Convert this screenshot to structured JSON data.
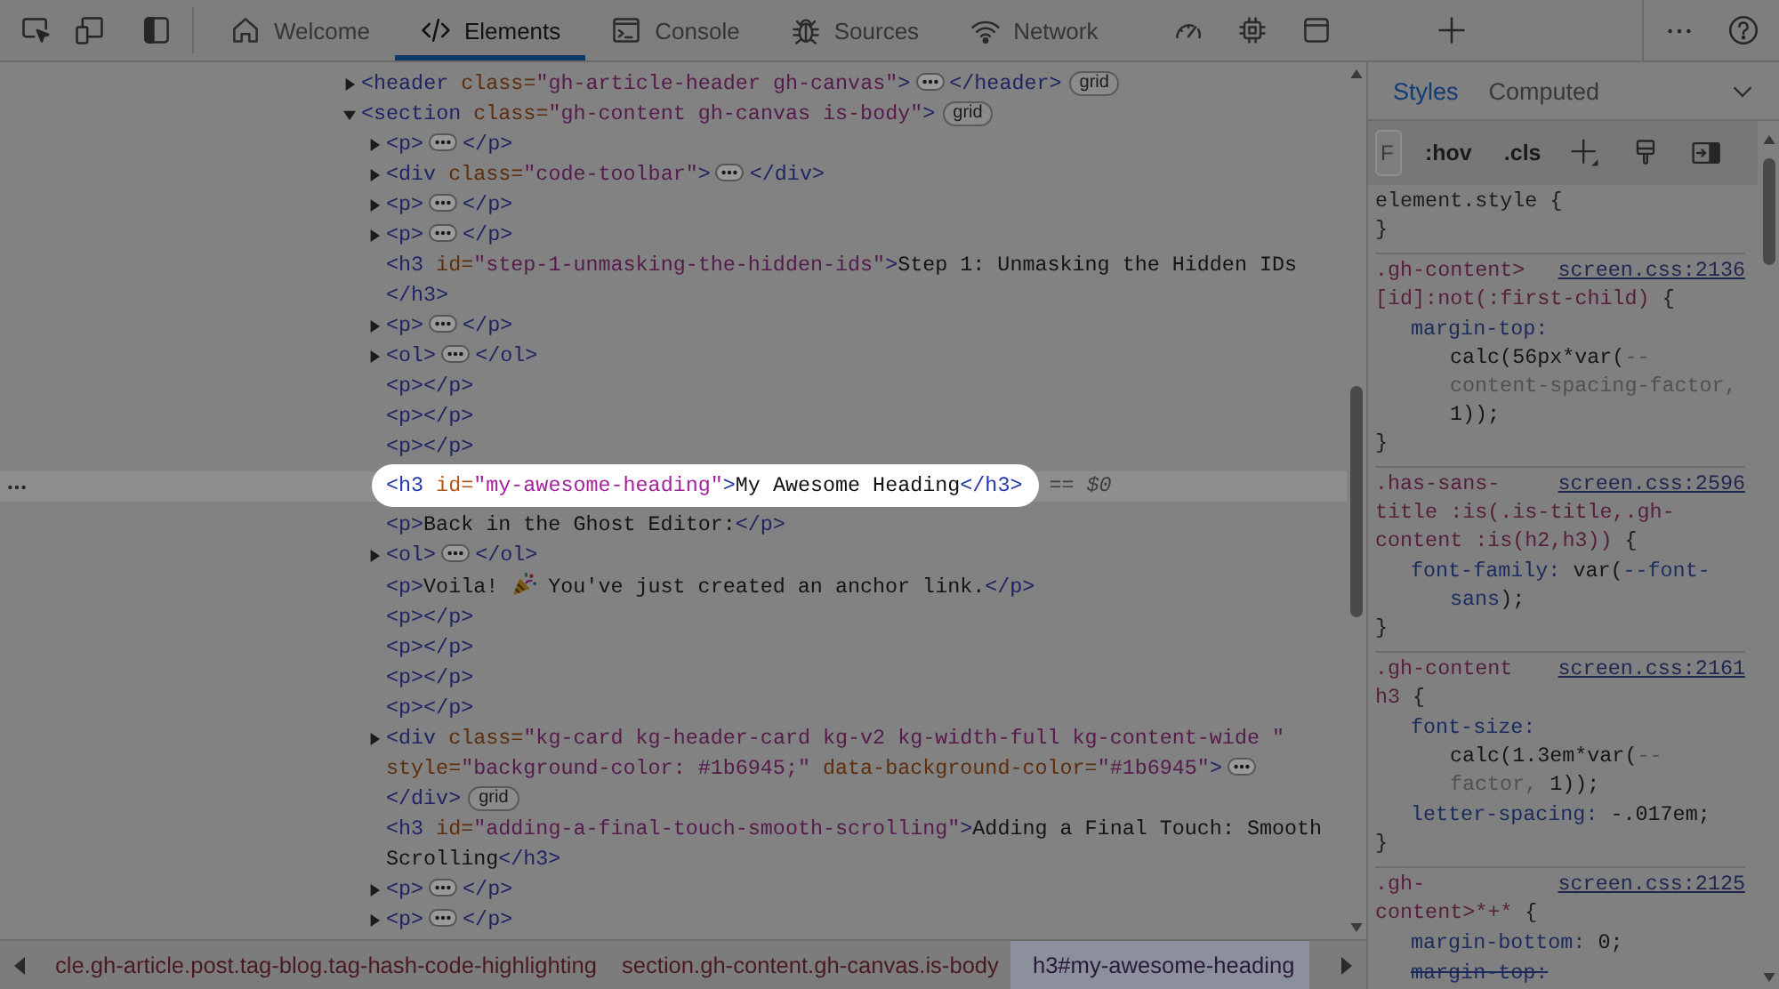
{
  "toolbar": {
    "tabs": [
      {
        "kind": "welcome",
        "label": "Welcome",
        "selected": false
      },
      {
        "kind": "elements",
        "label": "Elements",
        "selected": true
      },
      {
        "kind": "console",
        "label": "Console",
        "selected": false
      },
      {
        "kind": "sources",
        "label": "Sources",
        "selected": false
      },
      {
        "kind": "network",
        "label": "Network",
        "selected": false
      },
      {
        "kind": "performance",
        "selected": false
      },
      {
        "kind": "memory",
        "selected": false
      },
      {
        "kind": "application",
        "selected": false
      }
    ]
  },
  "dom_tree": {
    "nodes": [
      {
        "open": "<header class=\"gh-article-header gh-canvas\">",
        "expanded": false,
        "close": "</header>",
        "badge": "grid",
        "selected": false
      },
      {
        "open": "<section class=\"gh-content gh-canvas is-body\">",
        "expanded": true,
        "badge": "grid",
        "selected": false,
        "children": [
          {
            "open": "<p>",
            "expanded": false,
            "close": "</p>",
            "selected": false
          },
          {
            "open": "<div class=\"code-toolbar\">",
            "expanded": false,
            "close": "</div>",
            "selected": false
          },
          {
            "open": "<p>",
            "expanded": false,
            "close": "</p>",
            "selected": false
          },
          {
            "open": "<p>",
            "expanded": false,
            "close": "</p>",
            "selected": false
          },
          {
            "open": "<h3 id=\"step-1-unmasking-the-hidden-ids\">",
            "text": "Step 1: Unmasking the Hidden IDs",
            "close": "</h3>",
            "selected": false
          },
          {
            "open": "<p>",
            "expanded": false,
            "close": "</p>",
            "selected": false
          },
          {
            "open": "<ol>",
            "expanded": false,
            "close": "</ol>",
            "selected": false
          },
          {
            "open": "<p>",
            "close": "</p>",
            "selected": false
          },
          {
            "open": "<p>",
            "close": "</p>",
            "selected": false
          },
          {
            "open": "<p>",
            "close": "</p>",
            "selected": false
          },
          {
            "open": "<h3 id=\"my-awesome-heading\">",
            "text": "My Awesome Heading",
            "close": "</h3>",
            "selected": true,
            "console_ref": "== $0"
          },
          {
            "open": "<p>",
            "text": "Back in the Ghost Editor:",
            "close": "</p>",
            "selected": false
          },
          {
            "open": "<ol>",
            "expanded": false,
            "close": "</ol>",
            "selected": false
          },
          {
            "open": "<p>",
            "text": [
              "Voila!",
              "You've just created an anchor link."
            ],
            "close": "</p>",
            "selected": false
          },
          {
            "open": "<p>",
            "close": "</p>",
            "selected": false
          },
          {
            "open": "<p>",
            "close": "</p>",
            "selected": false
          },
          {
            "open": "<p>",
            "close": "</p>",
            "selected": false
          },
          {
            "open": "<p>",
            "close": "</p>",
            "selected": false
          },
          {
            "open": "<div class=\"kg-card kg-header-card kg-v2 kg-width-full kg-content-wide \" style=\"background-color: #1b6945;\" data-background-color=\"#1b6945\">",
            "expanded": false,
            "close": "</div>",
            "badge": "grid",
            "selected": false
          },
          {
            "open": "<h3 id=\"adding-a-final-touch-smooth-scrolling\">",
            "text": "Adding a Final Touch: Smooth Scrolling",
            "close": "</h3>",
            "selected": false
          },
          {
            "open": "<p>",
            "expanded": false,
            "close": "</p>",
            "selected": false
          },
          {
            "open": "<p>",
            "expanded": false,
            "close": "</p>",
            "selected": false
          }
        ]
      }
    ]
  },
  "breadcrumbs": [
    {
      "label": "cle.gh-article.post.tag-blog.tag-hash-code-highlighting",
      "selected": false
    },
    {
      "label": "section.gh-content.gh-canvas.is-body",
      "selected": false
    },
    {
      "label": "h3#my-awesome-heading",
      "selected": true
    }
  ],
  "styles_pane": {
    "tabs": [
      {
        "label": "Styles",
        "selected": true
      },
      {
        "label": "Computed",
        "selected": false
      }
    ],
    "filter": {
      "placeholder": "F"
    },
    "toggles": [
      ":hov",
      ".cls"
    ],
    "rules": [
      {
        "kind": "inline",
        "selector": "element.style",
        "open": "{",
        "close": "}"
      },
      {
        "kind": "matched",
        "selector": ".gh-content>[id]:not(:first-child)",
        "open": "{",
        "source": "screen.css:2136",
        "declarations": [
          {
            "property": "margin-top:",
            "value": [
              {
                "text": "calc(56px*var(",
                "kind": "plain"
              },
              {
                "text": "--content-spacing-factor,",
                "kind": "unresolved"
              },
              {
                "text": " 1));",
                "kind": "plain"
              }
            ],
            "overridden": false
          }
        ],
        "close": "}"
      },
      {
        "kind": "matched",
        "selector": ".has-sans-title :is(.is-title,.gh-content :is(h2,h3))",
        "open": "{",
        "source": "screen.css:2596",
        "declarations": [
          {
            "property": "font-family:",
            "value": [
              {
                "text": "var(",
                "kind": "plain"
              },
              {
                "text": "--font-sans",
                "kind": "variable"
              },
              {
                "text": ");",
                "kind": "plain"
              }
            ],
            "overridden": false
          }
        ],
        "close": "}"
      },
      {
        "kind": "matched",
        "selector": ".gh-content h3",
        "open": "{",
        "source": "screen.css:2161",
        "declarations": [
          {
            "property": "font-size:",
            "value": [
              {
                "text": "calc(1.3em*var(",
                "kind": "plain"
              },
              {
                "text": "--factor,",
                "kind": "unresolved"
              },
              {
                "text": " 1));",
                "kind": "plain"
              }
            ],
            "overridden": false
          },
          {
            "property": "letter-spacing:",
            "value": [
              {
                "text": "-.017em;",
                "kind": "plain"
              }
            ],
            "overridden": false
          }
        ],
        "close": "}"
      },
      {
        "kind": "matched",
        "selector": ".gh-content>*+*",
        "open": "{",
        "source": "screen.css:2125",
        "declarations": [
          {
            "property": "margin-bottom:",
            "value": [
              {
                "text": "0;",
                "kind": "plain"
              }
            ],
            "overridden": false
          },
          {
            "property": "margin-top:",
            "overridden": true
          }
        ]
      }
    ]
  }
}
